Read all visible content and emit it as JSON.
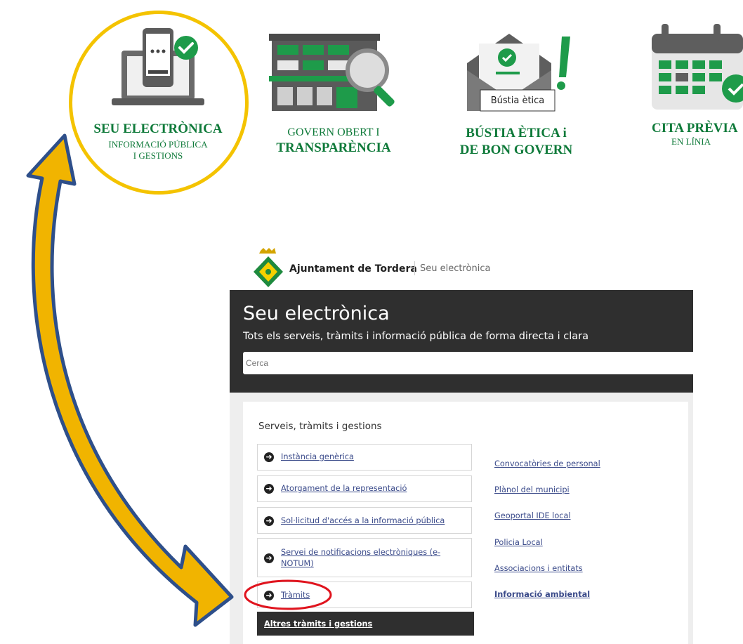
{
  "tiles": [
    {
      "key": "seu",
      "line1": "SEU ELECTRÒNICA",
      "line2": "INFORMACIÓ PÚBLICA",
      "line3": "I GESTIONS",
      "icon": "laptop-check-icon"
    },
    {
      "key": "govern",
      "line1": "GOVERN OBERT I",
      "line2": "TRANSPARÈNCIA",
      "icon": "building-magnifier-icon"
    },
    {
      "key": "bustia",
      "line1": "BÚSTIA ÈTICA  i",
      "line2": "DE  BON GOVERN",
      "tooltip": "Bústia ètica",
      "icon": "envelope-exclamation-icon"
    },
    {
      "key": "cita",
      "line1": "CITA PRÈVIA",
      "line2": "EN LÍNIA",
      "icon": "calendar-check-icon"
    }
  ],
  "portal": {
    "brand_name": "Ajuntament de Tordera",
    "brand_sub": "Seu electrònica",
    "hero_title": "Seu electrònica",
    "hero_subtitle": "Tots els serveis, tràmits i informació pública de forma directa i clara",
    "search_placeholder": "Cerca",
    "section_title": "Serveis, tràmits i gestions",
    "services": [
      "Instància genèrica",
      "Atorgament de la representació",
      "Sol·licitud d'accés a la informació pública",
      "Servei de notificacions electròniques (e-",
      "NOTUM)",
      "Tràmits"
    ],
    "other_label": "Altres tràmits i gestions",
    "right_links": [
      "Convocatòries de personal",
      "Plànol del municipi",
      "Geoportal IDE local",
      "Policia Local",
      "Associacions i entitats",
      "Informació ambiental"
    ]
  },
  "colors": {
    "green": "#0f7a3a",
    "highlight_circle": "#f4c300",
    "red_ellipse": "#e0141e",
    "arrow_fill": "#f1b400",
    "arrow_stroke": "#2e4f8a",
    "hero_bg": "#2f2f2f"
  }
}
